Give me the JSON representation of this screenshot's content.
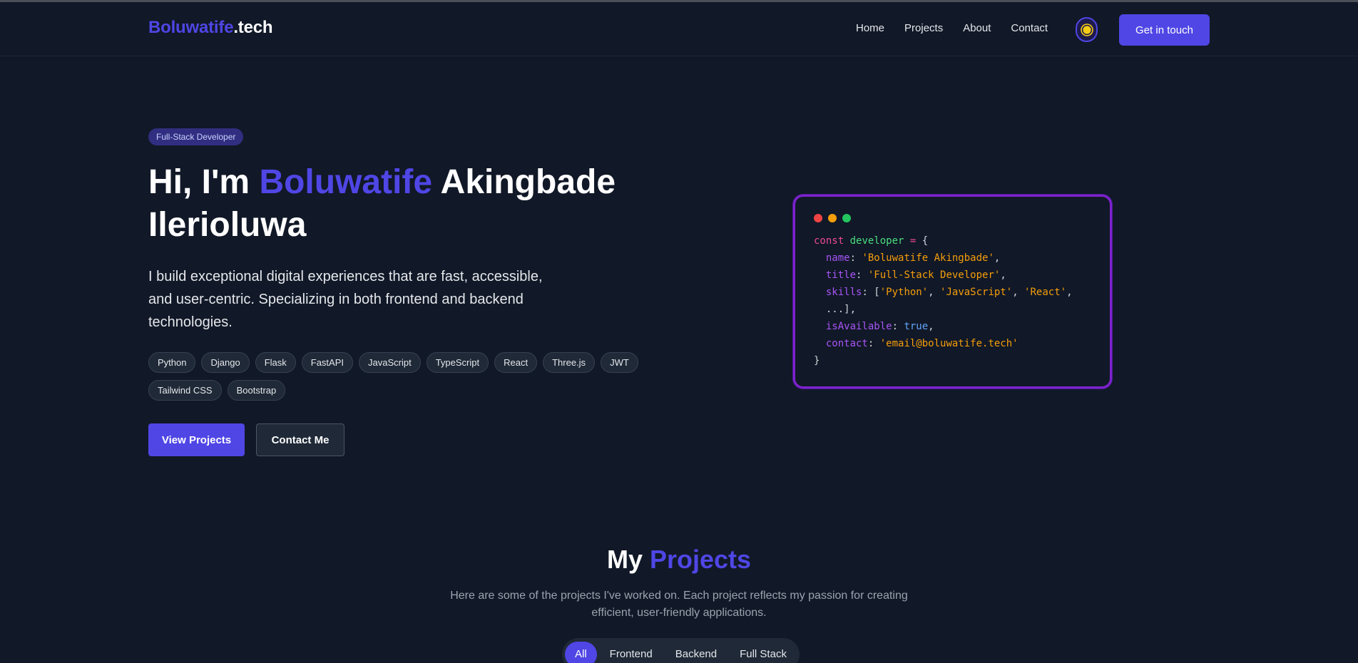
{
  "nav": {
    "brand_first": "Boluwatife",
    "brand_second": ".tech",
    "links": [
      "Home",
      "Projects",
      "About",
      "Contact"
    ],
    "theme_icon": "sun-icon",
    "cta_label": "Get in touch"
  },
  "hero": {
    "badge": "Full-Stack Developer",
    "title_prefix": "Hi, I'm ",
    "title_accent": "Boluwatife",
    "title_suffix": " Akingbade Ilerioluwa",
    "description": "I build exceptional digital experiences that are fast, accessible, and user-centric. Specializing in both frontend and backend technologies.",
    "tags": [
      "Python",
      "Django",
      "Flask",
      "FastAPI",
      "JavaScript",
      "TypeScript",
      "React",
      "Three.js",
      "JWT",
      "Tailwind CSS",
      "Bootstrap"
    ],
    "primary_button": "View Projects",
    "secondary_button": "Contact Me"
  },
  "code_card": {
    "dot_colors": [
      "#ef4444",
      "#f59e0b",
      "#22c55e"
    ],
    "kw": "const",
    "var_name": "developer",
    "name_key": "name",
    "name_value": "'Boluwatife Akingbade'",
    "title_key": "title",
    "title_value": "'Full-Stack Developer'",
    "skills_key": "skills",
    "skills_values": [
      "'Python'",
      "'JavaScript'",
      "'React'"
    ],
    "skills_tail": "...],",
    "available_key": "isAvailable",
    "available_value": "true",
    "contact_key": "contact",
    "contact_value": "'email@boluwatife.tech'"
  },
  "projects": {
    "title_prefix": "My ",
    "title_accent": "Projects",
    "subtitle": "Here are some of the projects I've worked on. Each project reflects my passion for creating efficient, user-friendly applications.",
    "filters": [
      "All",
      "Frontend",
      "Backend",
      "Full Stack"
    ],
    "active_filter": "All"
  },
  "colors": {
    "accent": "#4f46e5",
    "background": "#111827",
    "card_border": "#7e22ce"
  }
}
